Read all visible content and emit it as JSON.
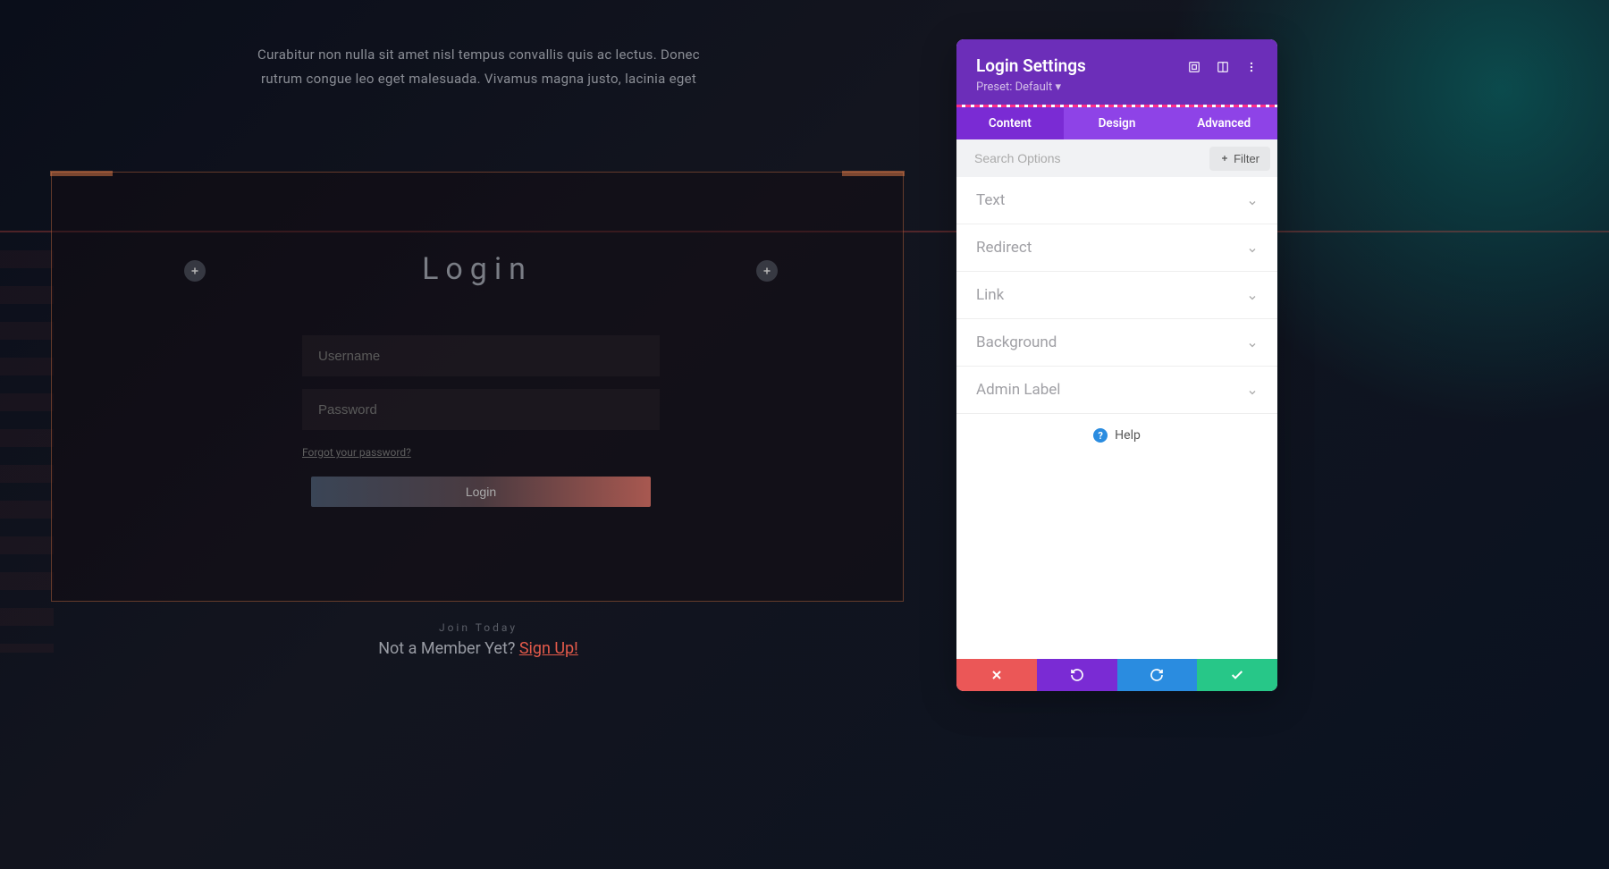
{
  "page": {
    "intro_text": "Curabitur non nulla sit amet nisl tempus convallis quis ac lectus. Donec rutrum congue leo eget malesuada. Vivamus magna justo, lacinia eget"
  },
  "login": {
    "title": "Login",
    "username_placeholder": "Username",
    "password_placeholder": "Password",
    "forgot_label": "Forgot your password?",
    "button_label": "Login"
  },
  "footer": {
    "join_label": "Join Today",
    "not_member_text": "Not a Member Yet? ",
    "signup_label": "Sign Up!"
  },
  "panel": {
    "title": "Login Settings",
    "preset_label": "Preset: Default",
    "tabs": {
      "content": "Content",
      "design": "Design",
      "advanced": "Advanced"
    },
    "search_placeholder": "Search Options",
    "filter_label": "Filter",
    "sections": {
      "text": "Text",
      "redirect": "Redirect",
      "link": "Link",
      "background": "Background",
      "admin_label": "Admin Label"
    },
    "help_label": "Help"
  }
}
